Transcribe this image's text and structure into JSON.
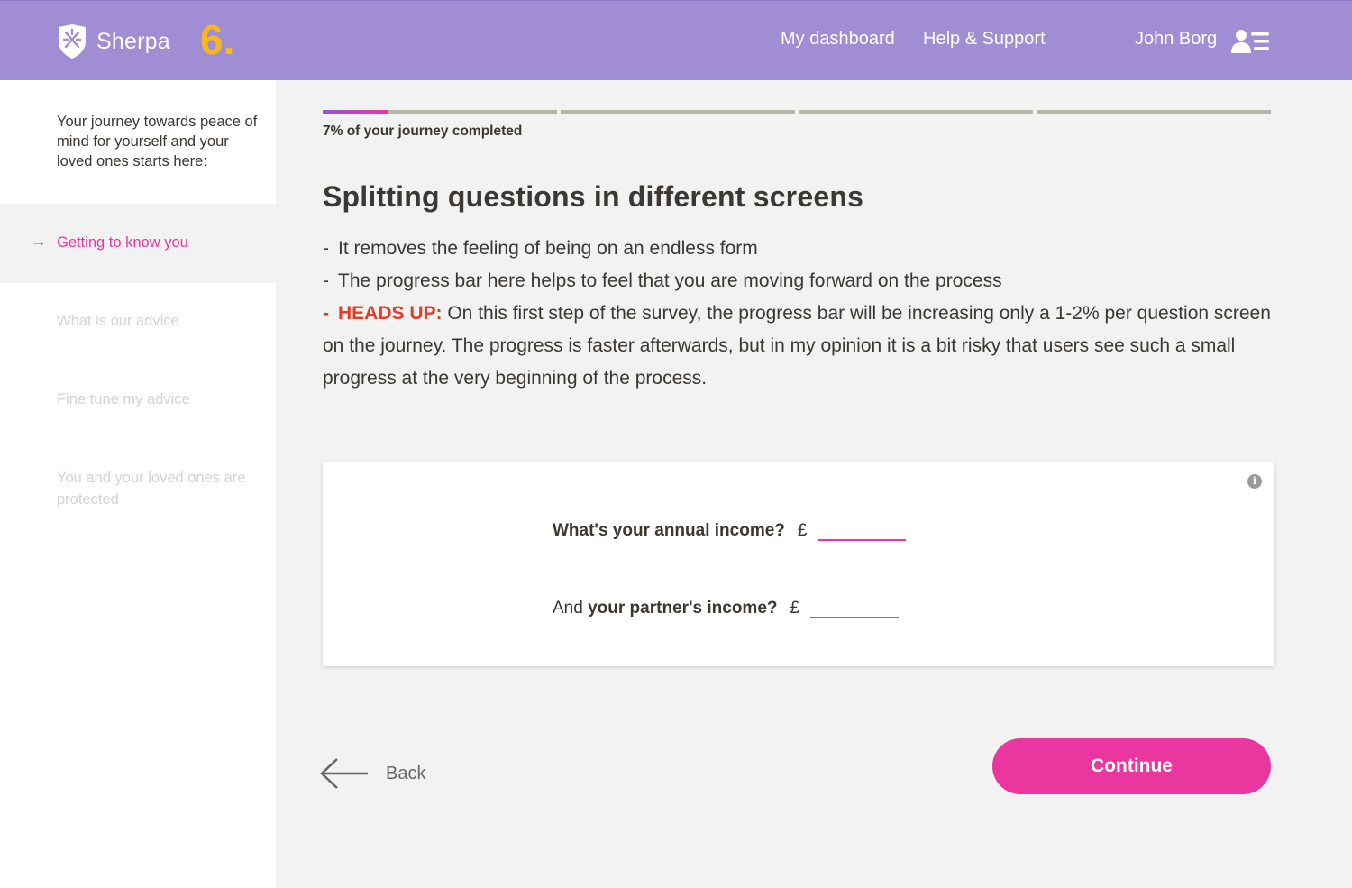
{
  "header": {
    "brand": "Sherpa",
    "step_number": "6.",
    "nav": {
      "dashboard": "My dashboard",
      "help": "Help & Support"
    },
    "user_name": "John Borg",
    "user_icon": "user-menu-icon",
    "logo_icon": "shield-logo-icon",
    "colors": {
      "header_bg": "#a08dd4",
      "step_accent": "#f7b81d"
    }
  },
  "sidebar": {
    "intro": "Your journey towards peace of mind for yourself and your loved ones starts here:",
    "active_item": "Getting to know you",
    "items": [
      "What is our advice",
      "Fine tune my advice",
      "You and your loved ones are protected"
    ],
    "colors": {
      "active": "#e9379f",
      "inactive": "#d3d3d3"
    }
  },
  "progress": {
    "percent": 7,
    "segments": 4,
    "label": "7% of your journey completed"
  },
  "content": {
    "title": "Splitting questions in different screens",
    "bullet1": "It removes the feeling of being on an endless form",
    "bullet2": "The progress bar here helps to feel that you are moving forward on the process",
    "heads_up_label": "HEADS UP:",
    "heads_up_text": " On this first step of the survey, the progress bar will be increasing only a 1-2% per question screen on the journey. The progress is faster afterwards, but in my opinion it is a bit risky that users see such a small progress at the very beginning of the process.",
    "dash": "-",
    "colors": {
      "heads_up": "#e23b26"
    }
  },
  "form": {
    "info_icon": "info-icon",
    "q1_label": "What's your annual income?",
    "q2_prefix": "And ",
    "q2_label": "your partner's income?",
    "currency": "£",
    "q1_value": "",
    "q2_value": ""
  },
  "actions": {
    "back_label": "Back",
    "continue_label": "Continue",
    "colors": {
      "primary": "#e9379f"
    }
  }
}
